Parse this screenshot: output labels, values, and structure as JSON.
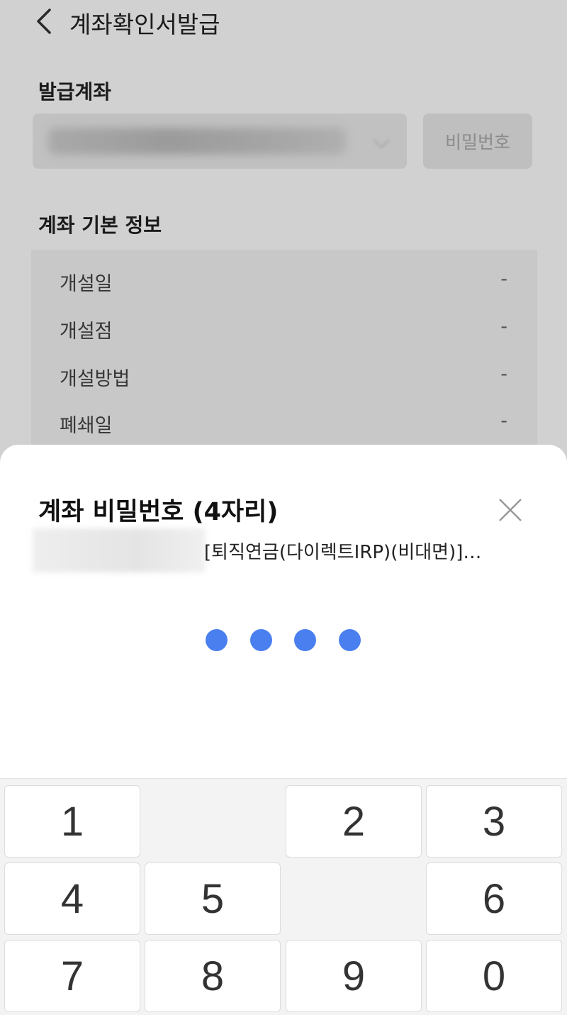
{
  "header": {
    "title": "계좌확인서발급"
  },
  "issue_account": {
    "label": "발급계좌",
    "password_button": "비밀번호"
  },
  "basic_info": {
    "label": "계좌 기본 정보",
    "rows": [
      {
        "label": "개설일",
        "value": "-"
      },
      {
        "label": "개설점",
        "value": "-"
      },
      {
        "label": "개설방법",
        "value": "-"
      },
      {
        "label": "폐쇄일",
        "value": "-"
      }
    ]
  },
  "password_sheet": {
    "title": "계좌 비밀번호 (4자리)",
    "account_name": "[퇴직연금(다이렉트IRP)(비대면)]…",
    "entered_digits": 4,
    "dot_color": "#4a7ff0"
  },
  "keypad": {
    "keys": [
      "1",
      "2",
      "3",
      "4",
      "5",
      "6",
      "7",
      "8",
      "9",
      "0"
    ]
  }
}
